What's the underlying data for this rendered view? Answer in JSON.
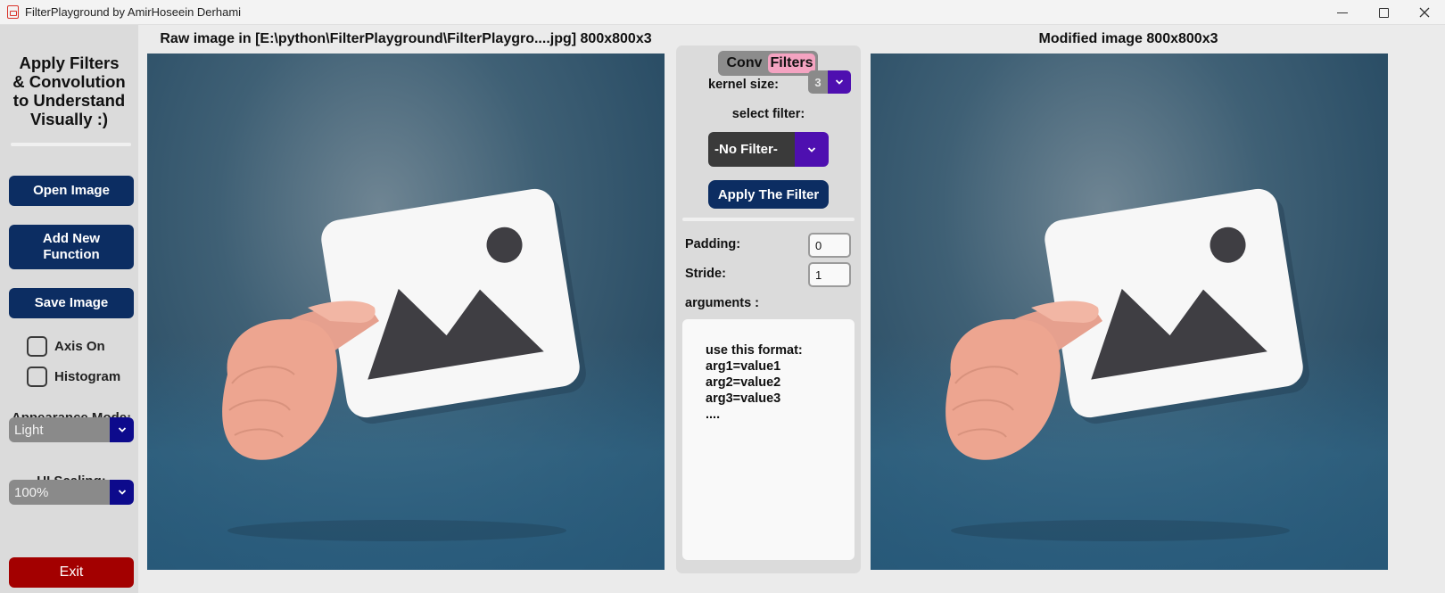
{
  "window": {
    "title": "FilterPlayground by AmirHoseein Derhami",
    "icon": "pdf-file-icon",
    "controls": [
      "minimize-icon",
      "maximize-icon",
      "close-icon"
    ]
  },
  "sidebar": {
    "title": "Apply Filters\n& Convolution\nto Understand\nVisually :)",
    "open_image": "Open Image",
    "add_function": "Add New\nFunction",
    "save_image": "Save Image",
    "axis_on": "Axis On",
    "histogram": "Histogram",
    "appearance_label": "Appearance Mode:",
    "appearance_value": "Light",
    "scaling_label": "UI Scaling:",
    "scaling_value": "100%",
    "exit": "Exit"
  },
  "raw_image": {
    "header": "Raw image in [E:\\python\\FilterPlayground\\FilterPlaygro....jpg] 800x800x3"
  },
  "modified_image": {
    "header": "Modified image 800x800x3"
  },
  "center": {
    "tabs": [
      "Conv",
      "Filters"
    ],
    "active_tab": "Filters",
    "kernel_size_label": "kernel size:",
    "kernel_size_value": "3",
    "select_filter_label": "select filter:",
    "filter_value": "-No Filter-",
    "apply_button": "Apply The Filter",
    "padding_label": "Padding:",
    "padding_value": "0",
    "stride_label": "Stride:",
    "stride_value": "1",
    "arguments_label": "arguments :",
    "arguments_text": "use this format:\narg1=value1\narg2=value2\narg3=value3\n...."
  },
  "colors": {
    "button_navy": "#0c2d62",
    "exit_red": "#a30000",
    "dropdown_purple": "#4e0fb0",
    "dropdown_blue": "#0d0a8c",
    "active_tab_pink": "#f4a3c1"
  }
}
